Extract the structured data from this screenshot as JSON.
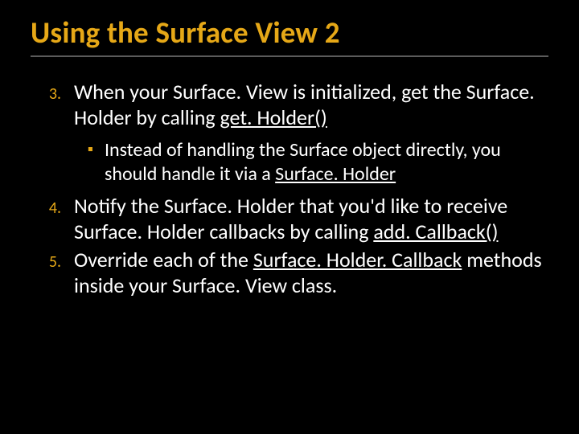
{
  "title": "Using the Surface View 2",
  "items": [
    {
      "num": "3.",
      "parts": [
        {
          "t": "When your Surface. View is initialized, get the Surface. Holder by calling "
        },
        {
          "t": "get. Holder()",
          "u": true
        }
      ],
      "sub": {
        "bullet": "▪",
        "parts": [
          {
            "t": "Instead of handling the Surface object directly, you should handle it via a "
          },
          {
            "t": "Surface. Holder",
            "u": true
          }
        ]
      }
    },
    {
      "num": "4.",
      "parts": [
        {
          "t": "Notify the Surface. Holder that you'd like to receive Surface. Holder callbacks by calling "
        },
        {
          "t": "add. Callback()",
          "u": true
        }
      ]
    },
    {
      "num": "5.",
      "parts": [
        {
          "t": "Override each of the "
        },
        {
          "t": "Surface. Holder. Callback",
          "u": true
        },
        {
          "t": " methods inside your Surface. View class."
        }
      ]
    }
  ]
}
